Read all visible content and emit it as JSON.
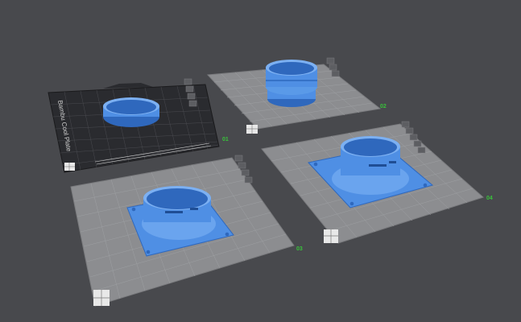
{
  "viewport": {
    "background": "#48494d"
  },
  "colors": {
    "part_blue": "#4f8fe4",
    "part_blue_dark": "#2f68bd",
    "part_blue_light": "#7cb0f2",
    "plate_light": "#8c8d90",
    "plate_dark": "#2a2b2f",
    "plate_number": "#38c23a",
    "grid_line": "#9ea0a3"
  },
  "plates": [
    {
      "number": "01",
      "label": "Bambu Cool Plate",
      "type": "textured-dark",
      "object": "ring"
    },
    {
      "number": "02",
      "type": "smooth",
      "object": "double-ring"
    },
    {
      "number": "03",
      "type": "smooth",
      "object": "fan-flange"
    },
    {
      "number": "04",
      "type": "smooth",
      "object": "fan-flange"
    }
  ],
  "plate_toolbar_icons": [
    "lock-icon",
    "settings-icon",
    "arrange-icon",
    "orient-icon"
  ]
}
